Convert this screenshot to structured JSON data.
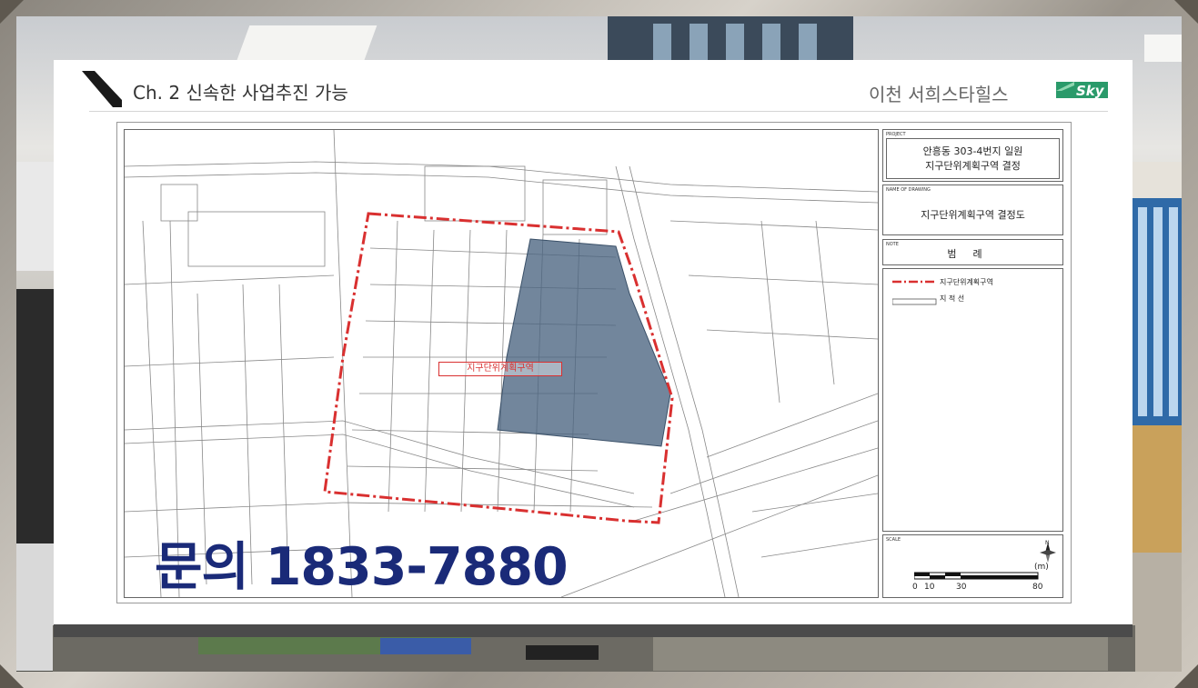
{
  "slide": {
    "title": "Ch. 2 신속한 사업추진 가능",
    "brand_text": "이천 서희스타힐스",
    "brand_logo_text": "Sky"
  },
  "map": {
    "district_label": "지구단위계획구역"
  },
  "panel": {
    "project_caption": "PROJECT",
    "project_line1": "안흥동 303-4번지 일원",
    "project_line2": "지구단위계획구역 결정",
    "drawing_caption": "NAME OF DRAWING",
    "drawing_name": "지구단위계획구역 결정도",
    "note_caption": "NOTE",
    "legend_title": "범례",
    "legend_items": [
      {
        "label": "지구단위계획구역"
      },
      {
        "label": "지 적 선"
      }
    ],
    "scale_caption": "SCALE",
    "scale_unit": "(m)",
    "north_label": "N",
    "scale_ticks": [
      "0",
      "10",
      "30",
      "80"
    ]
  },
  "contact": {
    "text": "문의 1833-7880"
  },
  "colors": {
    "district_boundary": "#d93030",
    "site_fill": "#4a6480",
    "contact_text": "#1a2a78"
  }
}
